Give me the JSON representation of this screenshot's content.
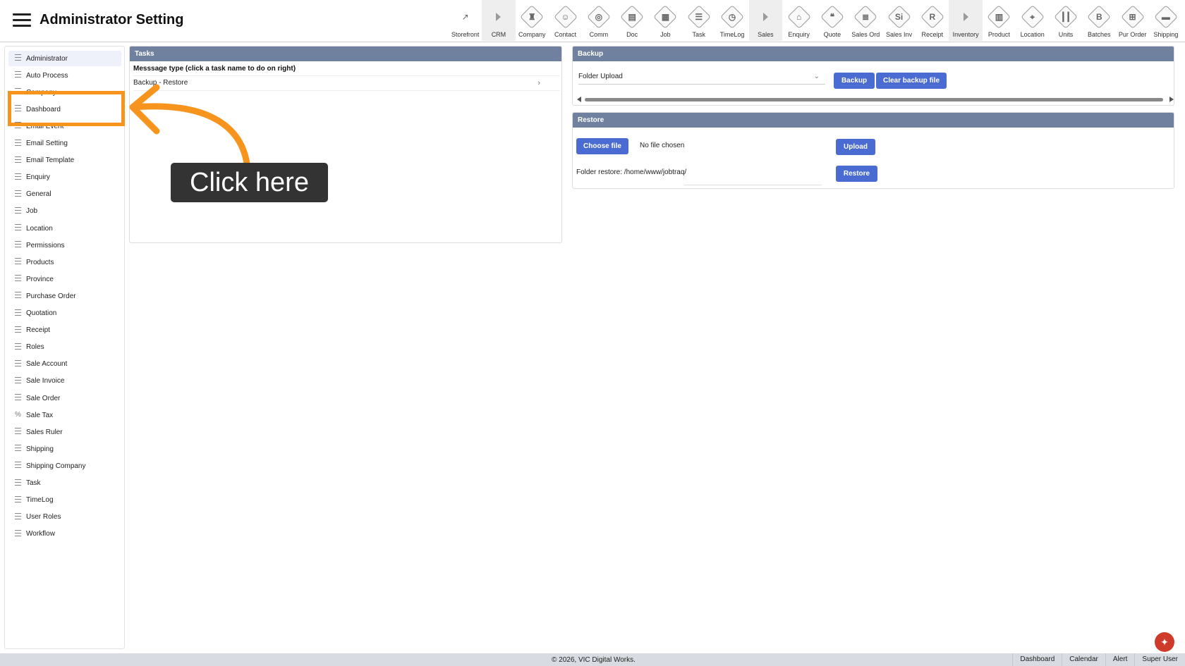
{
  "header": {
    "title": "Administrator Setting"
  },
  "toolbar": [
    {
      "label": "Storefront",
      "icon": "external-link-icon",
      "glyph": "↗",
      "kind": "plain"
    },
    {
      "label": "CRM",
      "icon": "caret-right-icon",
      "glyph": "",
      "kind": "section"
    },
    {
      "label": "Company",
      "icon": "company-icon",
      "glyph": "♜",
      "kind": "diamond"
    },
    {
      "label": "Contact",
      "icon": "contact-icon",
      "glyph": "☺",
      "kind": "diamond"
    },
    {
      "label": "Comm",
      "icon": "comm-icon",
      "glyph": "◎",
      "kind": "diamond"
    },
    {
      "label": "Doc",
      "icon": "doc-icon",
      "glyph": "▤",
      "kind": "diamond"
    },
    {
      "label": "Job",
      "icon": "job-icon",
      "glyph": "▦",
      "kind": "diamond"
    },
    {
      "label": "Task",
      "icon": "task-icon",
      "glyph": "☰",
      "kind": "diamond"
    },
    {
      "label": "TimeLog",
      "icon": "clock-icon",
      "glyph": "◷",
      "kind": "diamond"
    },
    {
      "label": "Sales",
      "icon": "caret-right-icon",
      "glyph": "",
      "kind": "section"
    },
    {
      "label": "Enquiry",
      "icon": "enquiry-icon",
      "glyph": "⌂",
      "kind": "diamond"
    },
    {
      "label": "Quote",
      "icon": "quote-icon",
      "glyph": "❝",
      "kind": "diamond"
    },
    {
      "label": "Sales Ord",
      "icon": "sales-order-icon",
      "glyph": "≣",
      "kind": "diamond"
    },
    {
      "label": "Sales Inv",
      "icon": "sales-invoice-icon",
      "glyph": "Si",
      "kind": "diamond"
    },
    {
      "label": "Receipt",
      "icon": "receipt-icon",
      "glyph": "R",
      "kind": "diamond"
    },
    {
      "label": "Inventory",
      "icon": "caret-right-icon",
      "glyph": "",
      "kind": "section"
    },
    {
      "label": "Product",
      "icon": "product-icon",
      "glyph": "▥",
      "kind": "diamond"
    },
    {
      "label": "Location",
      "icon": "location-icon",
      "glyph": "⌖",
      "kind": "diamond"
    },
    {
      "label": "Units",
      "icon": "units-icon",
      "glyph": "┃┃",
      "kind": "diamond"
    },
    {
      "label": "Batches",
      "icon": "batches-icon",
      "glyph": "B",
      "kind": "diamond"
    },
    {
      "label": "Pur Order",
      "icon": "cart-icon",
      "glyph": "⊞",
      "kind": "diamond"
    },
    {
      "label": "Shipping",
      "icon": "truck-icon",
      "glyph": "▬",
      "kind": "diamond"
    }
  ],
  "sidebar": {
    "items": [
      {
        "label": "Administrator",
        "active": true,
        "icon": "list-icon"
      },
      {
        "label": "Auto Process",
        "active": false,
        "icon": "list-icon"
      },
      {
        "label": "Company",
        "active": false,
        "icon": "list-icon"
      },
      {
        "label": "Dashboard",
        "active": false,
        "icon": "list-icon"
      },
      {
        "label": "Email Event",
        "active": false,
        "icon": "list-icon"
      },
      {
        "label": "Email Setting",
        "active": false,
        "icon": "list-icon"
      },
      {
        "label": "Email Template",
        "active": false,
        "icon": "list-icon"
      },
      {
        "label": "Enquiry",
        "active": false,
        "icon": "list-icon"
      },
      {
        "label": "General",
        "active": false,
        "icon": "list-icon"
      },
      {
        "label": "Job",
        "active": false,
        "icon": "list-icon"
      },
      {
        "label": "Location",
        "active": false,
        "icon": "list-icon"
      },
      {
        "label": "Permissions",
        "active": false,
        "icon": "list-icon"
      },
      {
        "label": "Products",
        "active": false,
        "icon": "list-icon"
      },
      {
        "label": "Province",
        "active": false,
        "icon": "list-icon"
      },
      {
        "label": "Purchase Order",
        "active": false,
        "icon": "list-icon"
      },
      {
        "label": "Quotation",
        "active": false,
        "icon": "list-icon"
      },
      {
        "label": "Receipt",
        "active": false,
        "icon": "list-icon"
      },
      {
        "label": "Roles",
        "active": false,
        "icon": "list-icon"
      },
      {
        "label": "Sale Account",
        "active": false,
        "icon": "list-icon"
      },
      {
        "label": "Sale Invoice",
        "active": false,
        "icon": "list-icon"
      },
      {
        "label": "Sale Order",
        "active": false,
        "icon": "list-icon"
      },
      {
        "label": "Sale Tax",
        "active": false,
        "icon": "percent-icon"
      },
      {
        "label": "Sales Ruler",
        "active": false,
        "icon": "list-icon"
      },
      {
        "label": "Shipping",
        "active": false,
        "icon": "list-icon"
      },
      {
        "label": "Shipping Company",
        "active": false,
        "icon": "list-icon"
      },
      {
        "label": "Task",
        "active": false,
        "icon": "list-icon"
      },
      {
        "label": "TimeLog",
        "active": false,
        "icon": "list-icon"
      },
      {
        "label": "User Roles",
        "active": false,
        "icon": "list-icon"
      },
      {
        "label": "Workflow",
        "active": false,
        "icon": "list-icon"
      }
    ]
  },
  "tasks": {
    "title": "Tasks",
    "subtitle": "Messsage type (click a task name to do on right)",
    "row_label": "Backup - Restore"
  },
  "backup": {
    "title": "Backup",
    "select_value": "Folder Upload",
    "backup_button": "Backup",
    "clear_button": "Clear backup file"
  },
  "restore": {
    "title": "Restore",
    "choose_file": "Choose file",
    "no_file": "No file chosen",
    "upload_button": "Upload",
    "folder_restore": "Folder restore: /home/www/jobtraq/",
    "restore_button": "Restore"
  },
  "tutorial": {
    "label": "Click here",
    "accent": "#f7941d"
  },
  "footer": {
    "copyright": "© 2026, VIC Digital Works.",
    "links": [
      "Dashboard",
      "Calendar",
      "Alert",
      "Super User"
    ]
  },
  "colors": {
    "panel_header": "#6f819e",
    "button": "#4a6bd1",
    "fab": "#cf3b2b"
  }
}
